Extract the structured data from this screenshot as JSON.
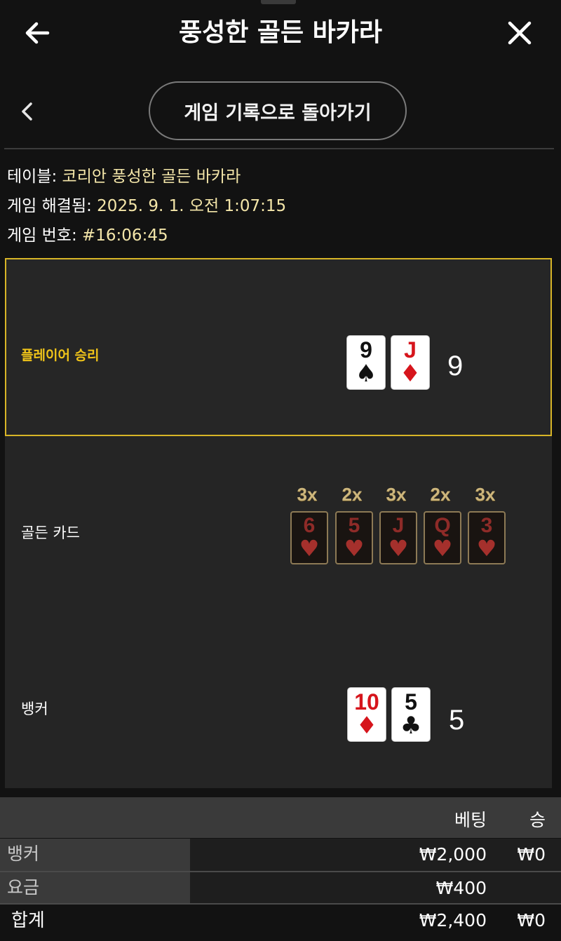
{
  "header": {
    "title": "풍성한 골든 바카라",
    "back_icon": "arrow-left-icon",
    "close_icon": "close-icon"
  },
  "subnav": {
    "chevron_icon": "chevron-left-icon",
    "history_button": "게임 기록으로 돌아가기"
  },
  "info": {
    "table_label": "테이블: ",
    "table_value": "코리안 풍성한 골든 바카라",
    "resolved_label": "게임 해결됨: ",
    "resolved_value": "2025. 9. 1. 오전 1:07:15",
    "game_no_label": "게임 번호: ",
    "game_no_value": "#16:06:45"
  },
  "player": {
    "label": "플레이어 승리",
    "cards": [
      {
        "rank": "9",
        "suit": "♠",
        "color": "black"
      },
      {
        "rank": "J",
        "suit": "♦",
        "color": "red"
      }
    ],
    "score": "9"
  },
  "golden": {
    "label": "골든 카드",
    "cards": [
      {
        "mult": "3x",
        "rank": "6",
        "suit": "♥"
      },
      {
        "mult": "2x",
        "rank": "5",
        "suit": "♥"
      },
      {
        "mult": "3x",
        "rank": "J",
        "suit": "♥"
      },
      {
        "mult": "2x",
        "rank": "Q",
        "suit": "♥"
      },
      {
        "mult": "3x",
        "rank": "3",
        "suit": "♥"
      }
    ]
  },
  "banker": {
    "label": "뱅커",
    "cards": [
      {
        "rank": "10",
        "suit": "♦",
        "color": "red"
      },
      {
        "rank": "5",
        "suit": "♣",
        "color": "black"
      }
    ],
    "score": "5"
  },
  "bets": {
    "headers": {
      "bet": "베팅",
      "win": "승"
    },
    "rows": [
      {
        "label": "뱅커",
        "bet": "₩2,000",
        "win": "₩0"
      },
      {
        "label": "요금",
        "bet": "₩400",
        "win": ""
      }
    ],
    "total": {
      "label": "합계",
      "bet": "₩2,400",
      "win": "₩0"
    }
  },
  "colors": {
    "accent_gold": "#f0c419",
    "info_value": "#f4e6a9",
    "card_red": "#d6151c",
    "golden_card_red": "#8e2b28"
  }
}
